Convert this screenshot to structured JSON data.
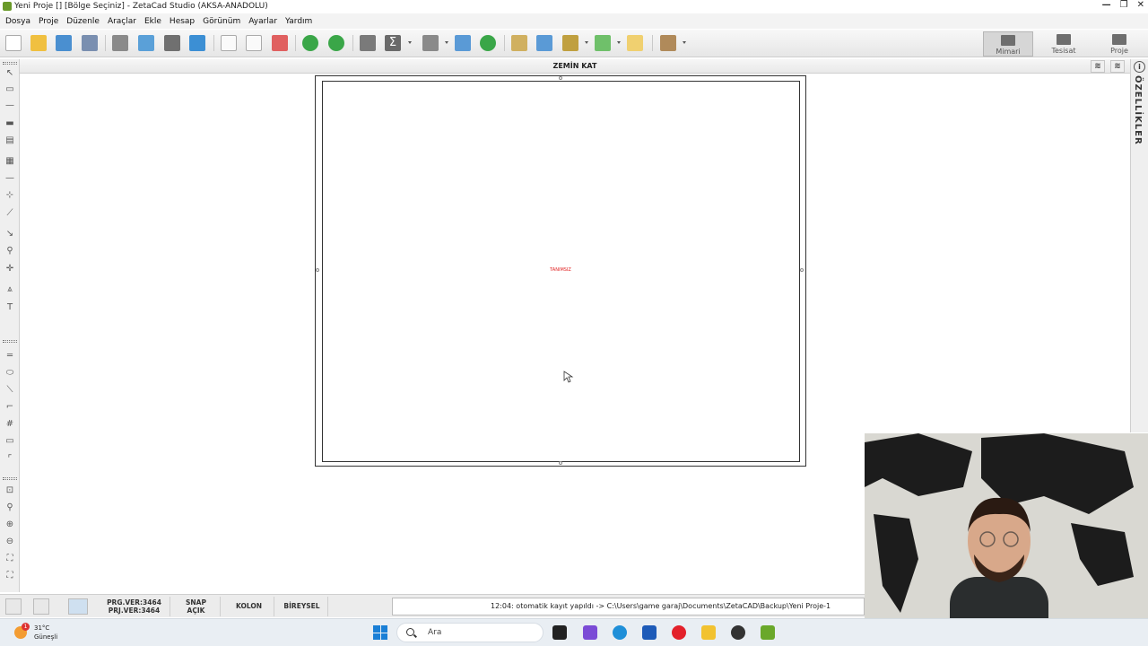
{
  "window": {
    "title": "Yeni Proje  []  [Bölge Seçiniz]  - ZetaCad Studio (AKSA-ANADOLU)",
    "controls": [
      "—",
      "❐",
      "✕"
    ]
  },
  "menu": [
    "Dosya",
    "Proje",
    "Düzenle",
    "Araçlar",
    "Ekle",
    "Hesap",
    "Görünüm",
    "Ayarlar",
    "Yardım"
  ],
  "modes": [
    {
      "label": "Mimari",
      "active": true
    },
    {
      "label": "Tesisat",
      "active": false
    },
    {
      "label": "Proje",
      "active": false
    }
  ],
  "floor_tab": {
    "label": "ZEMİN KAT"
  },
  "properties_panel": {
    "label": "ÖZELLİKLER"
  },
  "canvas": {
    "unnamed_label": "TANIMSIZ"
  },
  "status": {
    "prg_ver": "PRG.VER:3464",
    "prj_ver": "PRJ.VER:3464",
    "snap_line1": "SNAP",
    "snap_line2": "AÇIK",
    "kolon": "KOLON",
    "bireysel": "BİREYSEL",
    "autosave": "12:04: otomatik kayıt yapıldı -> C:\\Users\\game garaj\\Documents\\ZetaCAD\\Backup\\Yeni Proje-1"
  },
  "taskbar": {
    "weather_temp": "31°C",
    "weather_desc": "Güneşli",
    "weather_badge": "1",
    "search_placeholder": "Ara"
  },
  "colors": {
    "accent_red": "#e02020",
    "mode_active_bg": "#d6d6d6",
    "toolbar_green": "#3aa648",
    "windows_blue": "#1a7fd6"
  }
}
